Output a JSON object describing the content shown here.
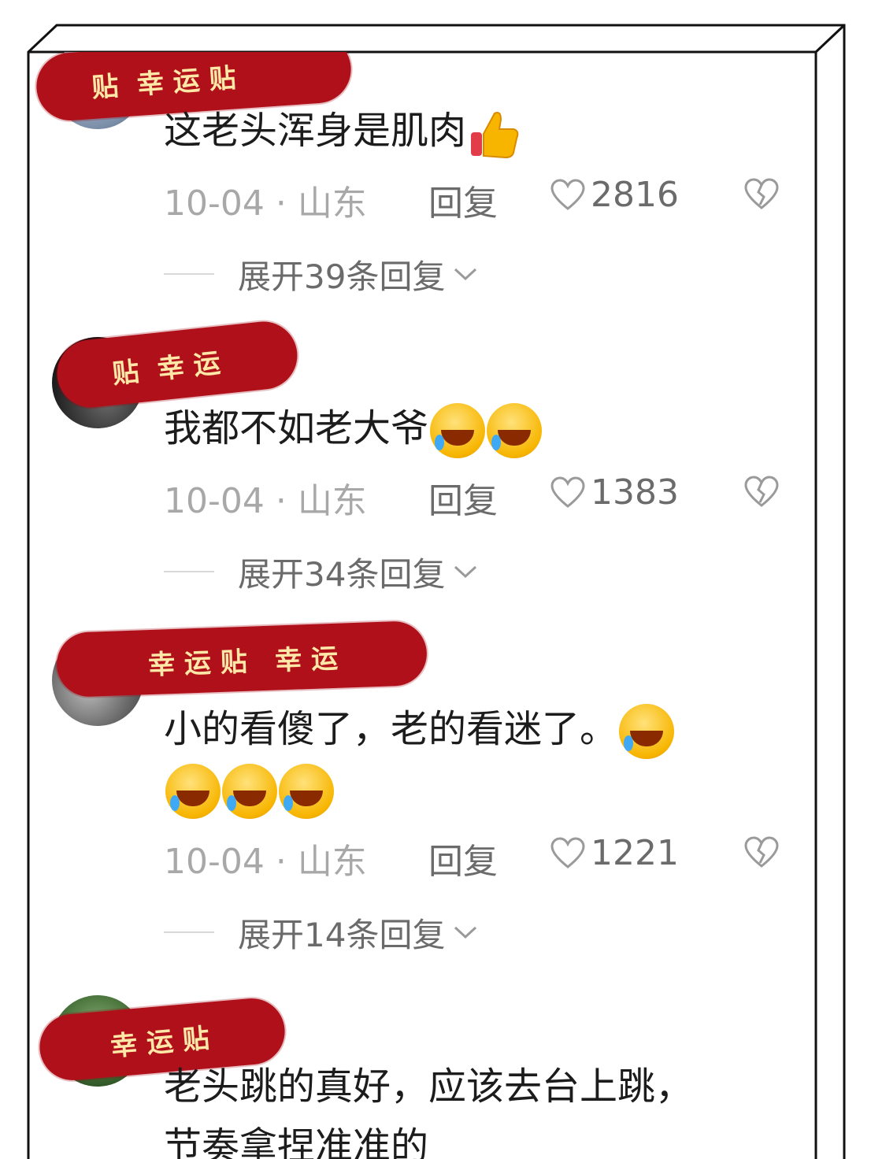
{
  "comments": [
    {
      "sticker": "贴  幸 运 贴",
      "text": "这老头浑身是肌肉",
      "emoji": [
        "thumbs-up"
      ],
      "date": "10-04 · 山东",
      "reply": "回复",
      "likes": "2816",
      "expand": "展开39条回复"
    },
    {
      "sticker": "贴  幸 运",
      "text": "我都不如老大爷",
      "emoji": [
        "rofl",
        "rofl"
      ],
      "date": "10-04 · 山东",
      "reply": "回复",
      "likes": "1383",
      "expand": "展开34条回复"
    },
    {
      "sticker": "幸 运 贴   幸 运",
      "text": "小的看傻了，老的看迷了。",
      "emoji": [
        "rofl",
        "rofl",
        "rofl",
        "rofl"
      ],
      "date": "10-04 · 山东",
      "reply": "回复",
      "likes": "1221",
      "expand": "展开14条回复"
    },
    {
      "sticker": "幸 运 贴",
      "text_line1": "老头跳的真好，应该去台上跳，",
      "text_line2": "节奏拿捏准准的"
    }
  ],
  "colors": {
    "sticker": "#b0101a",
    "meta": "#a8a8a8",
    "action": "#6b6b6b",
    "text": "#1c1c1c"
  },
  "icons": {
    "like": "heart-outline-icon",
    "dislike": "broken-heart-icon",
    "expand": "chevron-down-icon"
  }
}
